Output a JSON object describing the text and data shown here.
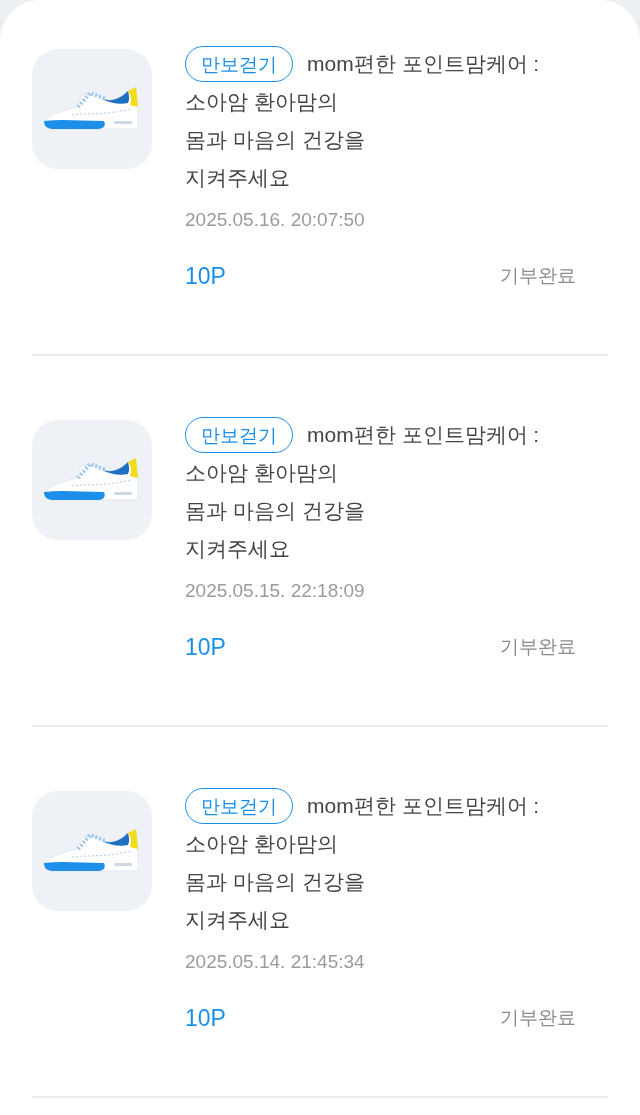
{
  "records": [
    {
      "tag": "만보걷기",
      "title_lines": [
        "mom편한 포인트맘케어 :",
        "소아암 환아맘의",
        "몸과 마음의 건강을",
        "지켜주세요"
      ],
      "datetime": "2025.05.16. 20:07:50",
      "points": "10P",
      "status": "기부완료"
    },
    {
      "tag": "만보걷기",
      "title_lines": [
        "mom편한 포인트맘케어 :",
        "소아암 환아맘의",
        "몸과 마음의 건강을",
        "지켜주세요"
      ],
      "datetime": "2025.05.15. 22:18:09",
      "points": "10P",
      "status": "기부완료"
    },
    {
      "tag": "만보걷기",
      "title_lines": [
        "mom편한 포인트맘케어 :",
        "소아암 환아맘의",
        "몸과 마음의 건강을",
        "지켜주세요"
      ],
      "datetime": "2025.05.14. 21:45:34",
      "points": "10P",
      "status": "기부완료"
    }
  ]
}
